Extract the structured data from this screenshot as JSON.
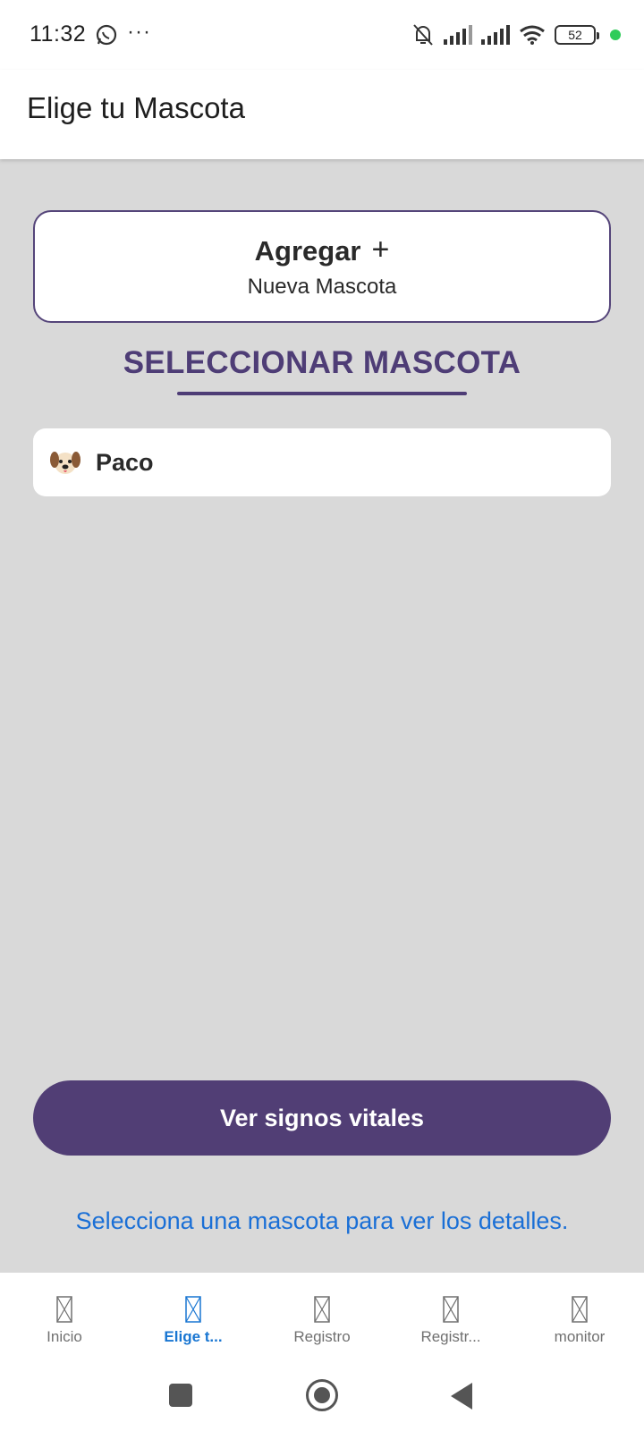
{
  "status_bar": {
    "time": "11:32",
    "more": "···",
    "battery": "52",
    "icons": [
      "whatsapp-icon",
      "bell-off-icon",
      "signal-icon",
      "signal-icon",
      "wifi-icon",
      "battery-icon"
    ]
  },
  "app_bar": {
    "title": "Elige tu Mascota"
  },
  "add_card": {
    "label": "Agregar",
    "plus": "+",
    "subtitle": "Nueva Mascota"
  },
  "section": {
    "title": "SELECCIONAR MASCOTA"
  },
  "pets": [
    {
      "name": "Paco",
      "icon": "dog-face-icon"
    }
  ],
  "actions": {
    "vitals_button": "Ver signos vitales"
  },
  "hint": "Selecciona una mascota para ver los detalles.",
  "bottom_nav": {
    "active_color": "#1976d2",
    "items": [
      {
        "label": "Inicio"
      },
      {
        "label": "Elige t..."
      },
      {
        "label": "Registro"
      },
      {
        "label": "Registr..."
      },
      {
        "label": "monitor"
      }
    ]
  },
  "colors": {
    "accent": "#513e75",
    "hint": "#1a6fd6",
    "background": "#d9d9d9"
  }
}
